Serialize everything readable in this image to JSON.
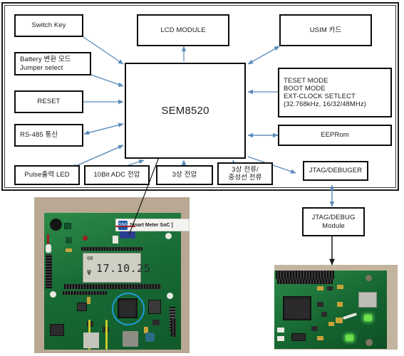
{
  "diagram": {
    "center_block": {
      "label": "SEM8520"
    },
    "boxes": [
      {
        "id": "switch-key",
        "label": "Switch Key"
      },
      {
        "id": "battery-jumper",
        "line1": "Battery 변환 모드",
        "line2": "Jumper select"
      },
      {
        "id": "reset",
        "label": "RESET"
      },
      {
        "id": "rs485",
        "label": "RS-485 통신"
      },
      {
        "id": "lcd-module",
        "label": "LCD MODULE"
      },
      {
        "id": "usim-card",
        "label": "USIM 카드"
      },
      {
        "id": "mode-clock",
        "line1": "TESET MODE",
        "line2": "BOOT MODE",
        "line3": "EXT-CLOCK SETLECT",
        "line4": "(32.768kHz, 16/32/48MHz)"
      },
      {
        "id": "eeprom",
        "label": "EEPRom"
      },
      {
        "id": "pulse-led",
        "label": "Pulse출력 LED"
      },
      {
        "id": "adc-voltage",
        "label": "10Bit ADC 전압"
      },
      {
        "id": "three-phase-voltage",
        "label": "3상 전압"
      },
      {
        "id": "three-phase-current",
        "line1": "3상 전류/",
        "line2": "중성선 전류"
      },
      {
        "id": "jtag-debuger",
        "label": "JTAG/DEBUGER"
      },
      {
        "id": "jtag-debug-module",
        "line1": "JTAG/DEBUG",
        "line2": "Module"
      }
    ],
    "connector_color": "#5b8cba",
    "pointer_color": "#1a1a1a",
    "box_border_color": "#0d0d0d"
  },
  "photos": {
    "main_board": {
      "name": "smart-meter-soc-board-photo",
      "silk_label_brand": "SNA",
      "silk_label_text": "Smart Meter SoC ]",
      "lcd_small_digits": "08",
      "lcd_main_digits": "17.10.25",
      "highlight_color": "#1f9ad6"
    },
    "debug_board": {
      "name": "jtag-debug-module-photo"
    }
  }
}
